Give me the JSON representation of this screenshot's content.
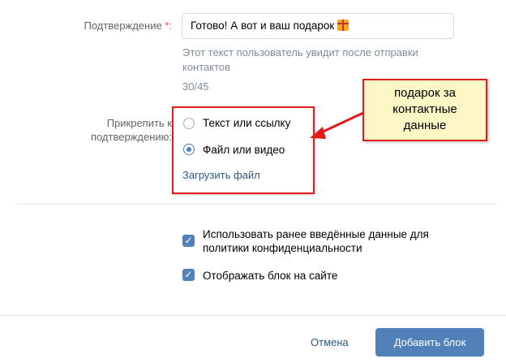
{
  "confirmation": {
    "label": "Подтверждение",
    "required_mark": "*:",
    "value": "Готово! А вот и ваш подарок",
    "gift_icon": "gift-icon",
    "hint_line1": "Этот текст пользователь увидит после отправки",
    "hint_line2": "контактов",
    "counter": "30/45"
  },
  "attach": {
    "label_line1": "Прикрепить к",
    "label_line2": "подтверждению:",
    "options": [
      {
        "label": "Текст или ссылку",
        "selected": false
      },
      {
        "label": "Файл или видео",
        "selected": true
      }
    ],
    "upload_link": "Загрузить файл"
  },
  "annotation": {
    "line1": "подарок за",
    "line2": "контактные",
    "line3": "данные",
    "border_color": "#e11a1a",
    "background": "#fdf7c6"
  },
  "options": [
    {
      "label_line1": "Использовать ранее введённые данные для",
      "label_line2": "политики конфиденциальности",
      "checked": true
    },
    {
      "label_line1": "Отображать блок на сайте",
      "label_line2": "",
      "checked": true
    }
  ],
  "footer": {
    "cancel_label": "Отмена",
    "submit_label": "Добавить блок"
  },
  "colors": {
    "accent": "#5181b8",
    "link": "#2a5885",
    "required": "#e64646"
  }
}
